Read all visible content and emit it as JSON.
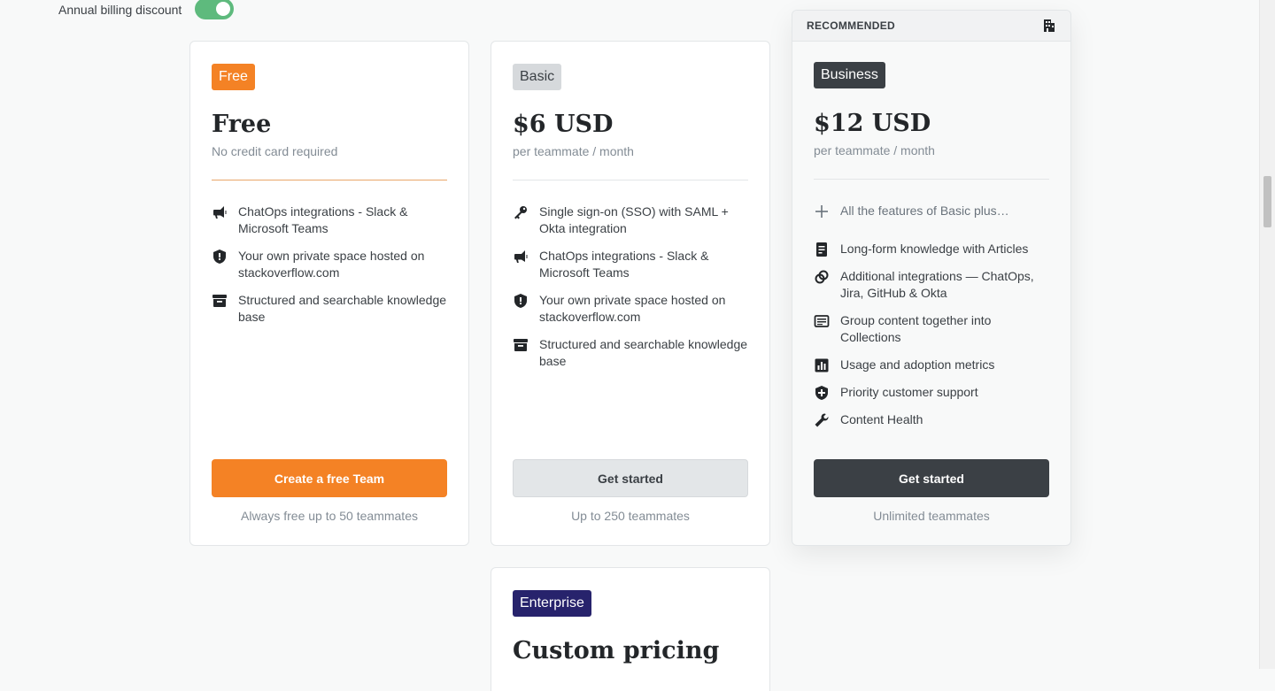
{
  "billing": {
    "label": "Annual billing discount",
    "enabled": true
  },
  "plans": {
    "free": {
      "badge": "Free",
      "price": "Free",
      "subtitle": "No credit card required",
      "features": [
        {
          "icon": "megaphone-icon",
          "text": "ChatOps integrations - Slack & Microsoft Teams"
        },
        {
          "icon": "shield-icon",
          "text": "Your own private space hosted on stackoverflow.com"
        },
        {
          "icon": "archive-icon",
          "text": "Structured and searchable knowledge base"
        }
      ],
      "button": "Create a free Team",
      "footnote": "Always free up to 50 teammates"
    },
    "basic": {
      "badge": "Basic",
      "price": "$6 USD",
      "subtitle": "per teammate / month",
      "features": [
        {
          "icon": "key-icon",
          "text": "Single sign-on (SSO) with SAML + Okta integration"
        },
        {
          "icon": "megaphone-icon",
          "text": "ChatOps integrations - Slack & Microsoft Teams"
        },
        {
          "icon": "shield-icon",
          "text": "Your own private space hosted on stackoverflow.com"
        },
        {
          "icon": "archive-icon",
          "text": "Structured and searchable knowledge base"
        }
      ],
      "button": "Get started",
      "footnote": "Up to 250 teammates"
    },
    "business": {
      "recommended_label": "RECOMMENDED",
      "badge": "Business",
      "price": "$12 USD",
      "subtitle": "per teammate / month",
      "features": [
        {
          "icon": "plus-icon",
          "text": "All the features of Basic plus…"
        },
        {
          "icon": "article-icon",
          "text": "Long-form knowledge with Articles"
        },
        {
          "icon": "link-icon",
          "text": "Additional integrations — ChatOps, Jira, GitHub & Okta"
        },
        {
          "icon": "collection-icon",
          "text": "Group content together into Collections"
        },
        {
          "icon": "chart-icon",
          "text": "Usage and adoption metrics"
        },
        {
          "icon": "shield-plus-icon",
          "text": "Priority customer support"
        },
        {
          "icon": "wrench-icon",
          "text": "Content Health"
        }
      ],
      "button": "Get started",
      "footnote": "Unlimited teammates"
    },
    "enterprise": {
      "badge": "Enterprise",
      "price": "Custom pricing"
    }
  },
  "colors": {
    "orange": "#f48225",
    "toggle_on": "#5eba7d",
    "dark": "#3b4045",
    "enterprise": "#27236c"
  }
}
